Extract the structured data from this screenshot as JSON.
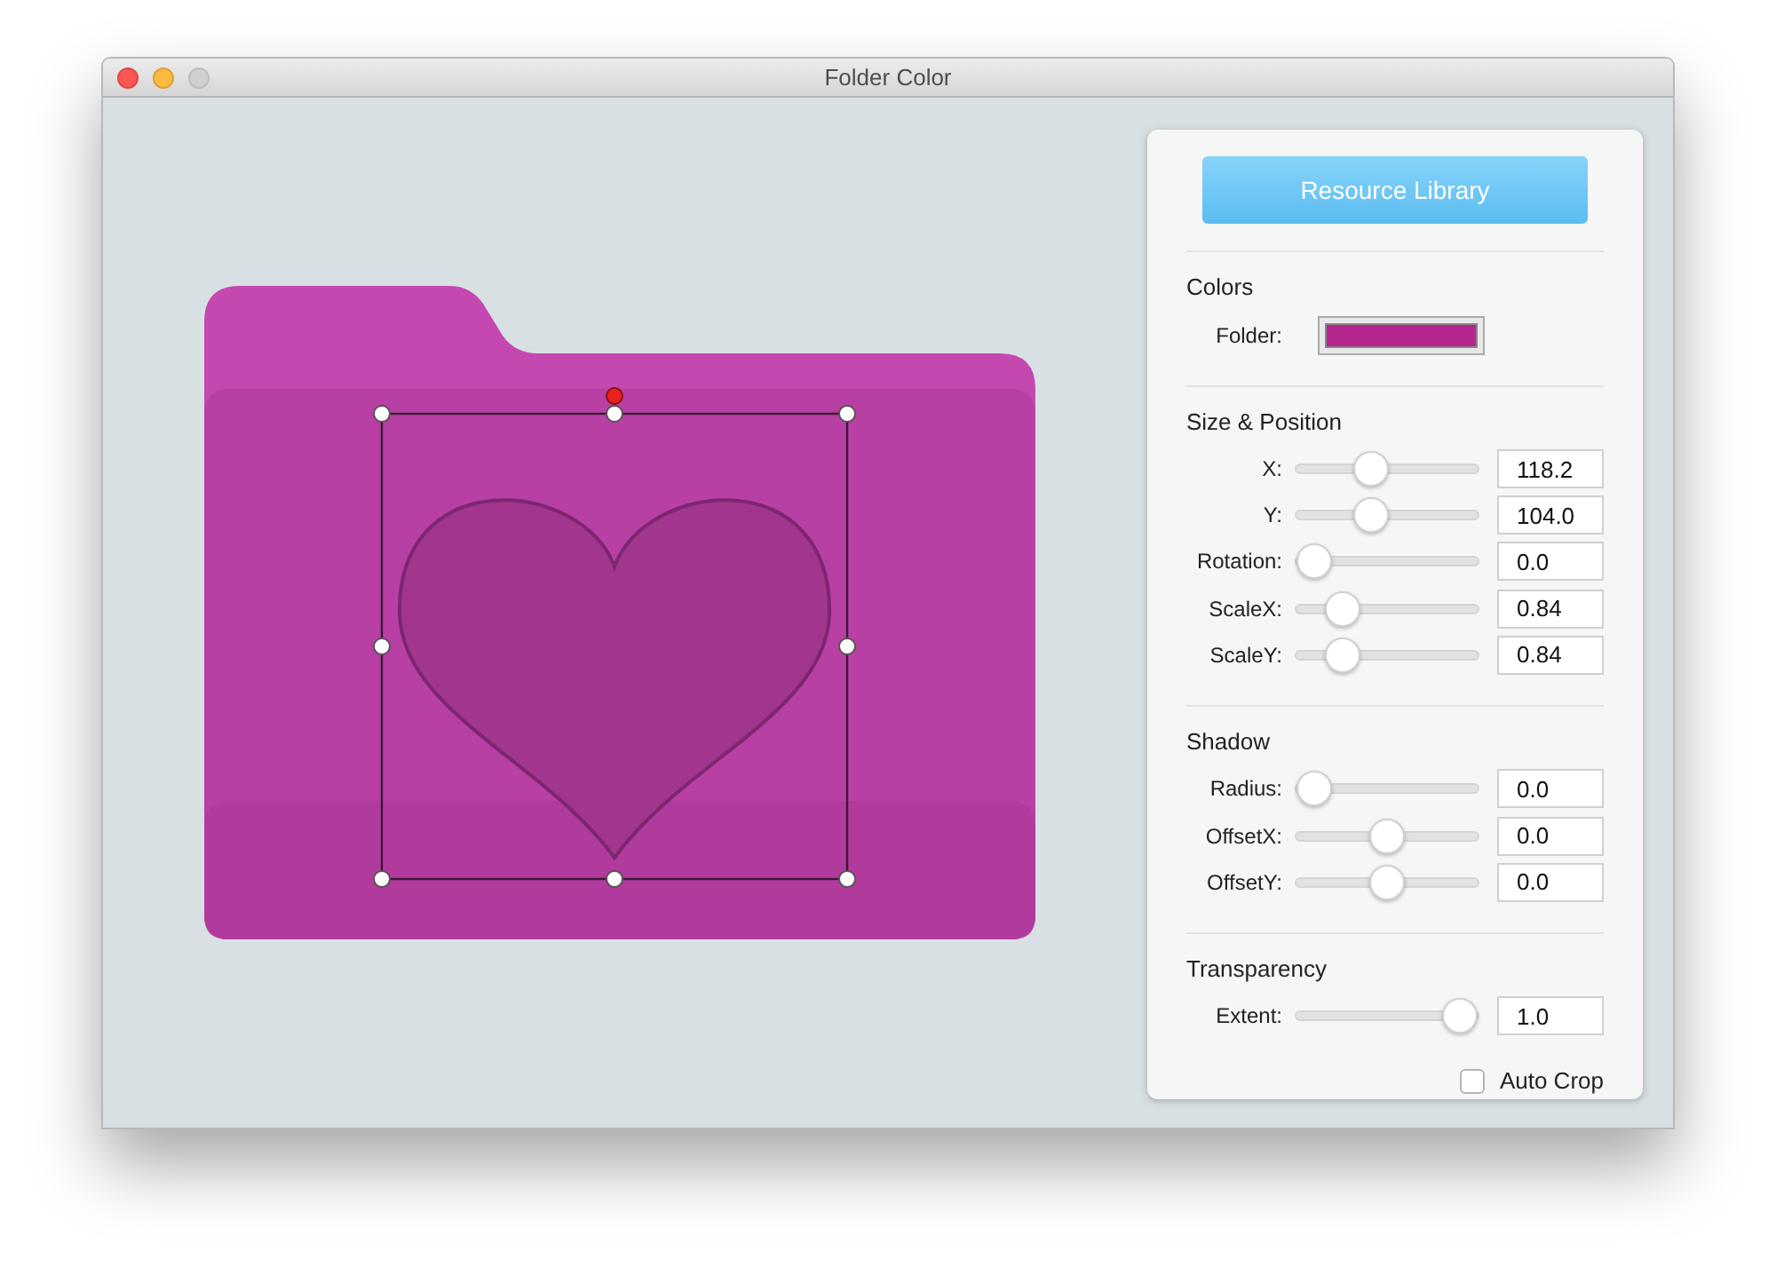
{
  "window": {
    "title": "Folder Color"
  },
  "panel": {
    "library_button": "Resource Library",
    "sections": [
      {
        "title": "Colors",
        "rows": [
          {
            "kind": "color",
            "label": "Folder:",
            "color": "#b5268f"
          }
        ]
      },
      {
        "title": "Size & Position",
        "rows": [
          {
            "kind": "slider",
            "label": "X:",
            "level": 0.39,
            "value": "118.2"
          },
          {
            "kind": "slider",
            "label": "Y:",
            "level": 0.39,
            "value": "104.0"
          },
          {
            "kind": "slider",
            "label": "Rotation:",
            "level": 0,
            "value": "0.0"
          },
          {
            "kind": "slider",
            "label": "ScaleX:",
            "level": 0.2,
            "value": "0.84"
          },
          {
            "kind": "slider",
            "label": "ScaleY:",
            "level": 0.2,
            "value": "0.84"
          }
        ]
      },
      {
        "title": "Shadow",
        "rows": [
          {
            "kind": "slider",
            "label": "Radius:",
            "level": 0,
            "value": "0.0"
          },
          {
            "kind": "slider",
            "label": "OffsetX:",
            "level": 0.5,
            "value": "0.0"
          },
          {
            "kind": "slider",
            "label": "OffsetY:",
            "level": 0.5,
            "value": "0.0"
          }
        ]
      },
      {
        "title": "Transparency",
        "rows": [
          {
            "kind": "slider",
            "label": "Extent:",
            "level": 1,
            "value": "1.0"
          }
        ]
      }
    ],
    "auto_crop": {
      "label": "Auto Crop",
      "checked": false
    }
  }
}
